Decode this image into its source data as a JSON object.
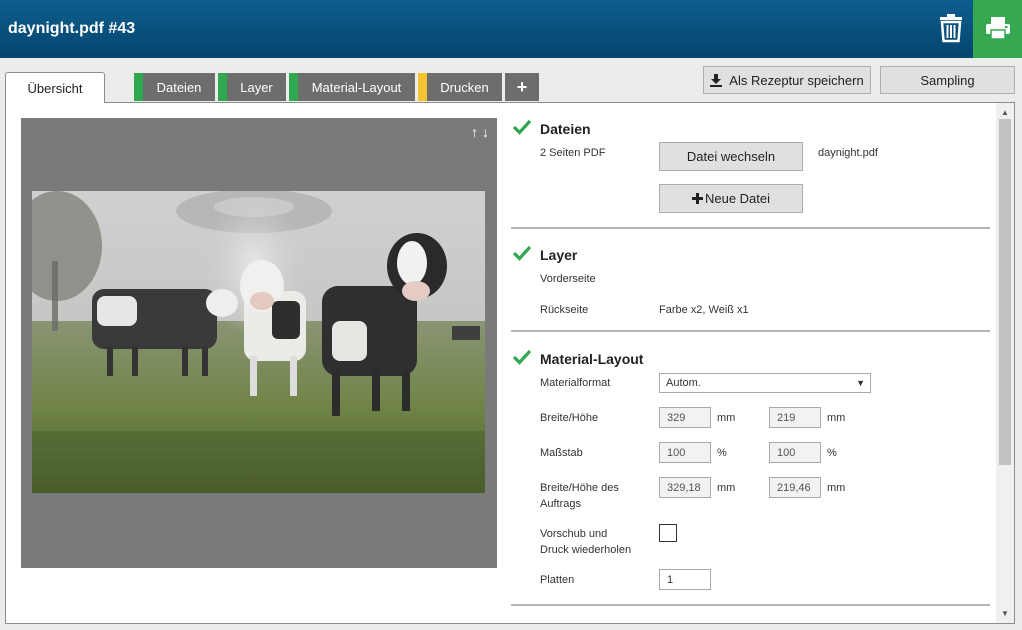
{
  "header": {
    "title": "daynight.pdf #43"
  },
  "tabs": [
    {
      "label": "Übersicht",
      "active": true
    },
    {
      "label": "Dateien",
      "status_color": "#2fa84f"
    },
    {
      "label": "Layer",
      "status_color": "#2fa84f"
    },
    {
      "label": "Material-Layout",
      "status_color": "#2fa84f"
    },
    {
      "label": "Drucken",
      "status_color": "#f4c430"
    }
  ],
  "tab_add_label": "+",
  "toolbar": {
    "save_recipe_label": "Als Rezeptur speichern",
    "sampling_label": "Sampling"
  },
  "preview": {
    "arrow_up": "↑",
    "arrow_down": "↓"
  },
  "dateien": {
    "title": "Dateien",
    "pages_label": "2 Seiten PDF",
    "change_file_label": "Datei wechseln",
    "filename": "daynight.pdf",
    "new_file_label": "Neue Datei"
  },
  "layer": {
    "title": "Layer",
    "front_label": "Vorderseite",
    "back_label": "Rückseite",
    "back_value": "Farbe x2, Weiß x1"
  },
  "material": {
    "title": "Material-Layout",
    "format_label": "Materialformat",
    "format_value": "Autom.",
    "size_label": "Breite/Höhe",
    "width": "329",
    "height": "219",
    "unit_mm": "mm",
    "scale_label": "Maßstab",
    "scale_x": "100",
    "scale_y": "100",
    "unit_pct": "%",
    "job_size_label_1": "Breite/Höhe des",
    "job_size_label_2": "Auftrags",
    "job_width": "329,18",
    "job_height": "219,46",
    "repeat_label_1": "Vorschub und",
    "repeat_label_2": "Druck wiederholen",
    "plates_label": "Platten",
    "plates_value": "1"
  },
  "colors": {
    "header": "#05456e",
    "print": "#36a852",
    "ok": "#2fa84f",
    "warn": "#f4c430"
  }
}
